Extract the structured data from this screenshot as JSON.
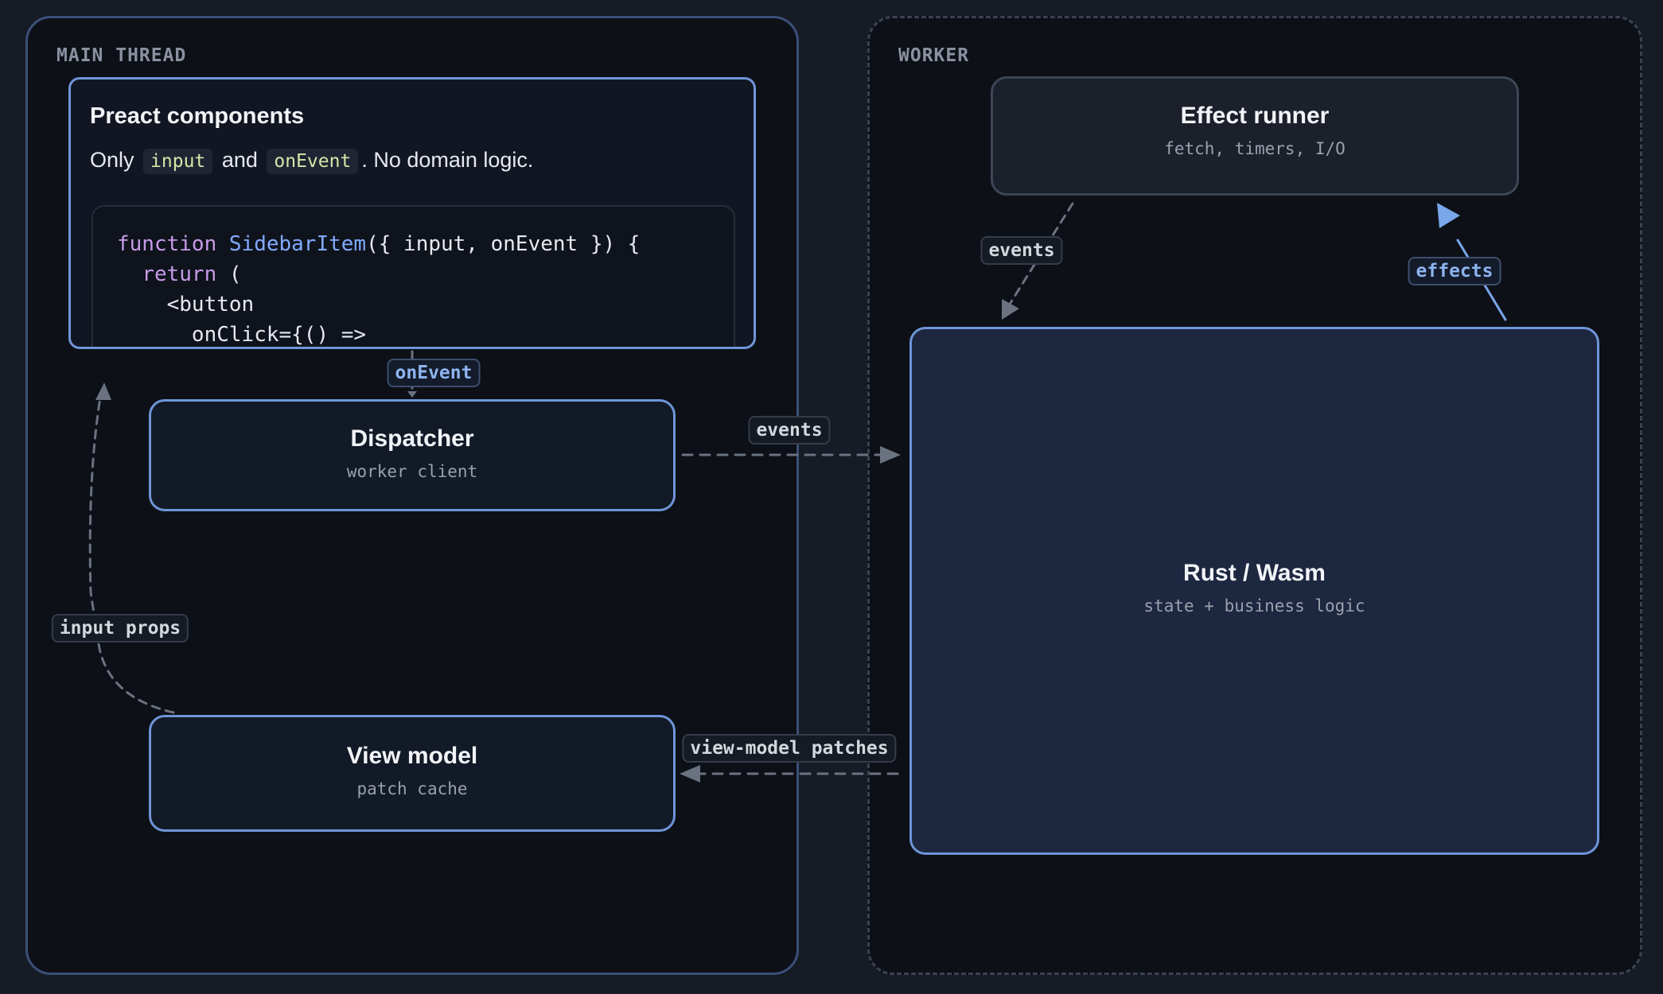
{
  "regions": {
    "main_thread": "MAIN THREAD",
    "worker": "WORKER"
  },
  "preact": {
    "title": "Preact components",
    "desc_prefix": "Only",
    "chip_input": "input",
    "desc_and": "and",
    "chip_onevent": "onEvent",
    "desc_suffix": ". No domain logic.",
    "code": {
      "line1_kw": "function",
      "line1_fn": "SidebarItem",
      "line1_rest": "({ input, onEvent }) {",
      "line2_kw": "return",
      "line2_rest": "(",
      "line3": "<button",
      "line4": "onClick={() =>"
    }
  },
  "nodes": {
    "dispatcher": {
      "title": "Dispatcher",
      "sub": "worker client"
    },
    "view_model": {
      "title": "View model",
      "sub": "patch cache"
    },
    "effect_runner": {
      "title": "Effect runner",
      "sub": "fetch, timers, I/O"
    },
    "rust_wasm": {
      "title": "Rust / Wasm",
      "sub": "state + business logic"
    }
  },
  "edges": {
    "on_event": "onEvent",
    "events_to_worker": "events",
    "view_model_patches": "view-model patches",
    "input_props": "input props",
    "events_from_effects": "events",
    "effects": "effects"
  },
  "colors": {
    "background": "#161b25",
    "panel": "#0d1017",
    "accent_border": "#6f95d8",
    "accent_arrow": "#7aa6ea",
    "muted_arrow": "#6b7280"
  }
}
